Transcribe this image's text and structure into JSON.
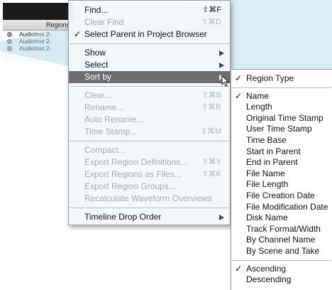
{
  "background_window": {
    "header": "Regions",
    "rows": [
      "AudioInst 2-",
      "AudioInst 2-",
      "AudioInst 2-"
    ]
  },
  "main_menu": {
    "items": [
      {
        "label": "Find...",
        "shortcut": "⇧⌘F",
        "disabled": false
      },
      {
        "label": "Clear Find",
        "shortcut": "⇧⌘D",
        "disabled": true
      },
      {
        "label": "Select Parent in Project Browser",
        "checked": true,
        "disabled": false
      },
      {
        "label": "Show"
      },
      {
        "label": "Select"
      },
      {
        "label": "Sort by"
      },
      {
        "label": "Clear...",
        "shortcut": "⇧⌘B",
        "disabled": true
      },
      {
        "label": "Rename...",
        "shortcut": "⇧⌘R",
        "disabled": true
      },
      {
        "label": "Auto Rename...",
        "disabled": true
      },
      {
        "label": "Time Stamp...",
        "shortcut": "⇧⌘M",
        "disabled": true
      },
      {
        "label": "Compact...",
        "disabled": true
      },
      {
        "label": "Export Region Definitions...",
        "shortcut": "⇧⌘Y",
        "disabled": true
      },
      {
        "label": "Export Regions as Files...",
        "shortcut": "⇧⌘K",
        "disabled": true
      },
      {
        "label": "Export Region Groups...",
        "disabled": true
      },
      {
        "label": "Recalculate Waveform Overviews",
        "disabled": true
      },
      {
        "label": "Timeline Drop Order"
      }
    ],
    "check_mark": "✓"
  },
  "sort_submenu": {
    "items": [
      {
        "label": "Region Type",
        "checked": true
      },
      {
        "label": "Name",
        "checked": true
      },
      {
        "label": "Length"
      },
      {
        "label": "Original Time Stamp"
      },
      {
        "label": "User Time Stamp"
      },
      {
        "label": "Time Base"
      },
      {
        "label": "Start in Parent"
      },
      {
        "label": "End in Parent"
      },
      {
        "label": "File Name"
      },
      {
        "label": "File Length"
      },
      {
        "label": "File Creation Date"
      },
      {
        "label": "File Modification Date"
      },
      {
        "label": "Disk Name"
      },
      {
        "label": "Track Format/Width"
      },
      {
        "label": "By Channel Name"
      },
      {
        "label": "By Scene and Take"
      },
      {
        "label": "Ascending",
        "checked": true
      },
      {
        "label": "Descending"
      }
    ]
  },
  "colors": {
    "highlight": "#6e6e6e",
    "disabled_text": "#a8a8a8",
    "overlay_tint": "#a9d8e6"
  },
  "icons": {
    "submenu_arrow": "triangle-right-icon",
    "cursor": "pointer-cursor-icon",
    "row_icon": "region-dot-icon"
  }
}
